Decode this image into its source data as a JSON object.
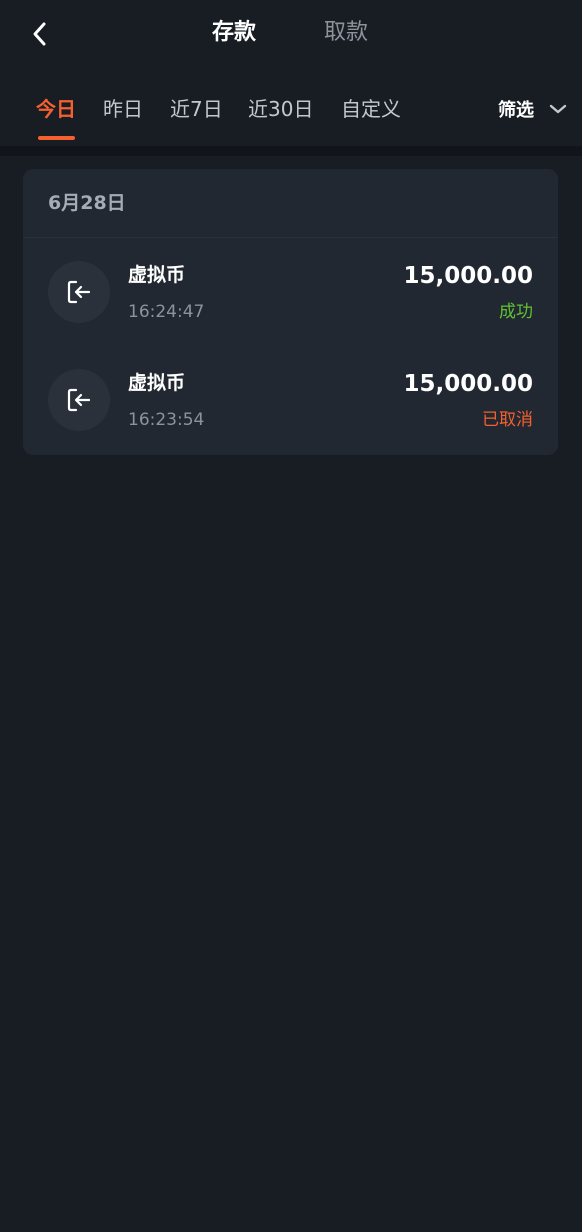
{
  "header": {
    "tabs": [
      {
        "label": "存款",
        "active": true
      },
      {
        "label": "取款",
        "active": false
      }
    ]
  },
  "periods": {
    "items": [
      {
        "label": "今日",
        "active": true
      },
      {
        "label": "昨日",
        "active": false
      },
      {
        "label": "近7日",
        "active": false
      },
      {
        "label": "近30日",
        "active": false
      },
      {
        "label": "自定义",
        "active": false
      }
    ],
    "filter_label": "筛选"
  },
  "groups": [
    {
      "date": "6月28日",
      "transactions": [
        {
          "title": "虚拟币",
          "time": "16:24:47",
          "amount": "15,000.00",
          "status": "成功",
          "status_color": "#61c133"
        },
        {
          "title": "虚拟币",
          "time": "16:23:54",
          "amount": "15,000.00",
          "status": "已取消",
          "status_color": "#f4602e"
        }
      ]
    }
  ],
  "colors": {
    "background": "#181d24",
    "card": "#212831",
    "accent": "#f4602e",
    "success": "#61c133"
  },
  "icons": {
    "back": "chevron-left-icon",
    "filter": "chevron-down-icon",
    "deposit": "deposit-arrow-icon"
  }
}
